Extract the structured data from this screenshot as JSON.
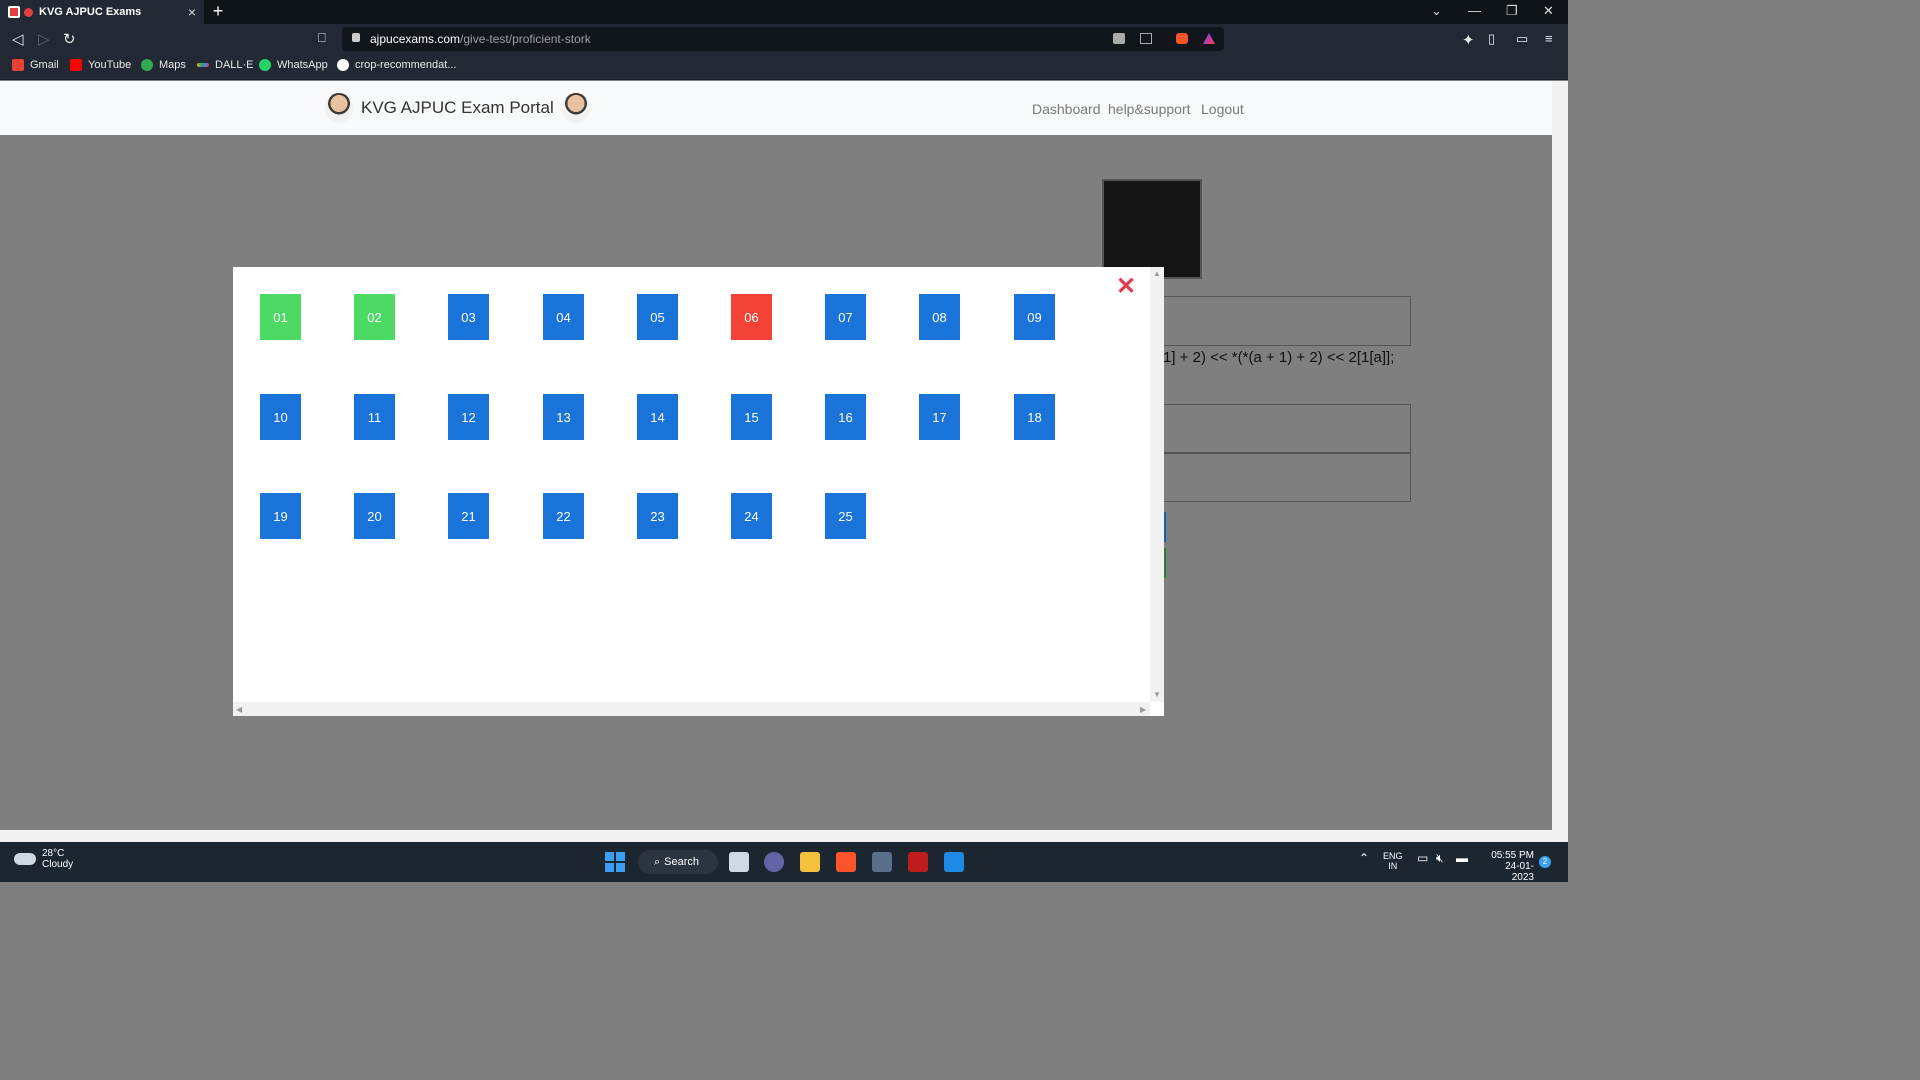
{
  "browser": {
    "tab_title": "KVG AJPUC Exams",
    "url_domain": "ajpucexams.com",
    "url_path": "/give-test/proficient-stork",
    "bookmarks": [
      {
        "label": "Gmail",
        "color": "#ea4335"
      },
      {
        "label": "YouTube",
        "color": "#ff0000"
      },
      {
        "label": "Maps",
        "color": "#34a853"
      },
      {
        "label": "DALL·E",
        "color": "#f4b400"
      },
      {
        "label": "WhatsApp",
        "color": "#25d366"
      },
      {
        "label": "crop-recommendat...",
        "color": "#ffffff"
      }
    ]
  },
  "navbar": {
    "brand": "KVG AJPUC Exam Portal",
    "links": [
      "Dashboard",
      "help&support",
      "Logout"
    ]
  },
  "background": {
    "code_fragment": "1] + 2) << *(*(a + 1) + 2) << 2[1[a]];"
  },
  "modal": {
    "close_glyph": "✕",
    "questions": [
      {
        "num": "01",
        "status": "answered"
      },
      {
        "num": "02",
        "status": "answered"
      },
      {
        "num": "03",
        "status": "unvisited"
      },
      {
        "num": "04",
        "status": "unvisited"
      },
      {
        "num": "05",
        "status": "unvisited"
      },
      {
        "num": "06",
        "status": "current"
      },
      {
        "num": "07",
        "status": "unvisited"
      },
      {
        "num": "08",
        "status": "unvisited"
      },
      {
        "num": "09",
        "status": "unvisited"
      },
      {
        "num": "10",
        "status": "unvisited"
      },
      {
        "num": "11",
        "status": "unvisited"
      },
      {
        "num": "12",
        "status": "unvisited"
      },
      {
        "num": "13",
        "status": "unvisited"
      },
      {
        "num": "14",
        "status": "unvisited"
      },
      {
        "num": "15",
        "status": "unvisited"
      },
      {
        "num": "16",
        "status": "unvisited"
      },
      {
        "num": "17",
        "status": "unvisited"
      },
      {
        "num": "18",
        "status": "unvisited"
      },
      {
        "num": "19",
        "status": "unvisited"
      },
      {
        "num": "20",
        "status": "unvisited"
      },
      {
        "num": "21",
        "status": "unvisited"
      },
      {
        "num": "22",
        "status": "unvisited"
      },
      {
        "num": "23",
        "status": "unvisited"
      },
      {
        "num": "24",
        "status": "unvisited"
      },
      {
        "num": "25",
        "status": "unvisited"
      }
    ],
    "status_colors": {
      "answered": "#4cd964",
      "current": "#f44336",
      "unvisited": "#1a73d9"
    }
  },
  "taskbar": {
    "temperature": "28°C",
    "weather": "Cloudy",
    "search_label": "Search",
    "lang_line1": "ENG",
    "lang_line2": "IN",
    "time": "05:55 PM",
    "date": "24-01-2023",
    "notification_count": "2"
  }
}
